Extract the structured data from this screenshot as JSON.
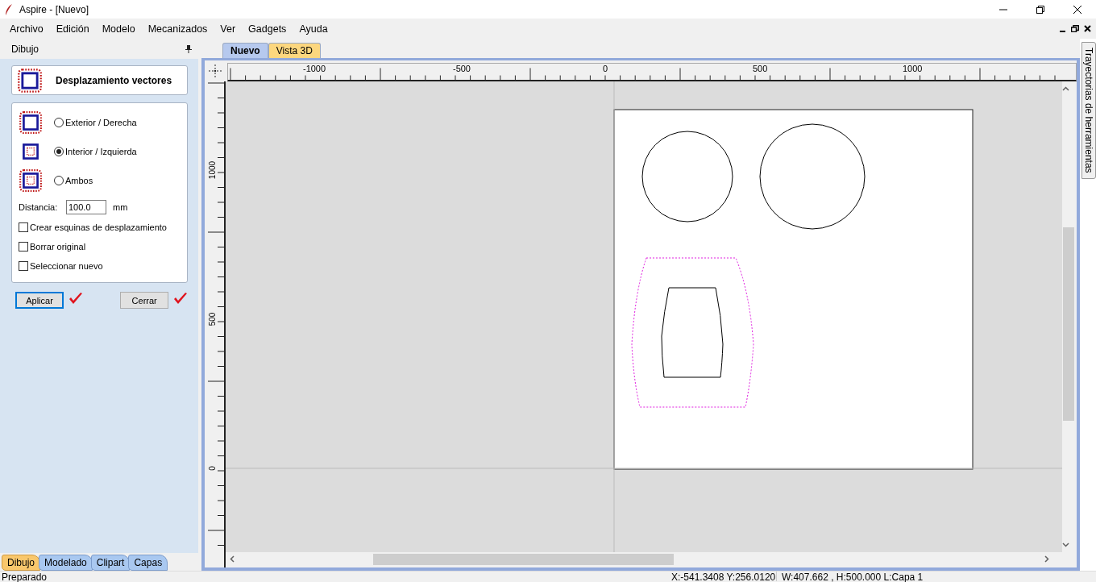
{
  "window": {
    "title": "Aspire - [Nuevo]"
  },
  "menu": [
    "Archivo",
    "Edición",
    "Modelo",
    "Mecanizados",
    "Ver",
    "Gadgets",
    "Ayuda"
  ],
  "panel": {
    "title": "Dibujo",
    "header": {
      "title": "Desplazamiento vectores",
      "kind": "outer"
    },
    "options": [
      {
        "label": "Exterior / Derecha",
        "kind": "outer",
        "selected": false
      },
      {
        "label": "Interior / Izquierda",
        "kind": "inner",
        "selected": true
      },
      {
        "label": "Ambos",
        "kind": "both",
        "selected": false
      }
    ],
    "distance": {
      "label": "Distancia:",
      "value": "100.0",
      "unit": "mm"
    },
    "checkboxes": [
      {
        "label": "Crear esquinas de desplazamiento",
        "checked": false
      },
      {
        "label": "Borrar original",
        "checked": false
      },
      {
        "label": "Seleccionar nuevo",
        "checked": false
      }
    ],
    "buttons": [
      {
        "label": "Aplicar",
        "focused": true
      },
      {
        "label": "Cerrar",
        "focused": false
      }
    ]
  },
  "bottom_tabs": [
    {
      "label": "Dibujo",
      "selected": true
    },
    {
      "label": "Modelado",
      "selected": false
    },
    {
      "label": "Clipart",
      "selected": false
    },
    {
      "label": "Capas",
      "selected": false
    }
  ],
  "document_tabs": [
    {
      "label": "Nuevo",
      "selected": true
    },
    {
      "label": "Vista 3D",
      "selected": false
    }
  ],
  "rulers": {
    "horizontal": [
      "-1000",
      "-500",
      "0",
      "500",
      "1000"
    ],
    "vertical": [
      "1000",
      "500",
      "0"
    ]
  },
  "side_tab": "Trayectorias de herramientas",
  "status_bar": {
    "message": "Preparado",
    "coordinates": "X:-541.3408 Y:256.0120",
    "selection": "W:407.662 , H:500.000 L:Capa 1"
  }
}
